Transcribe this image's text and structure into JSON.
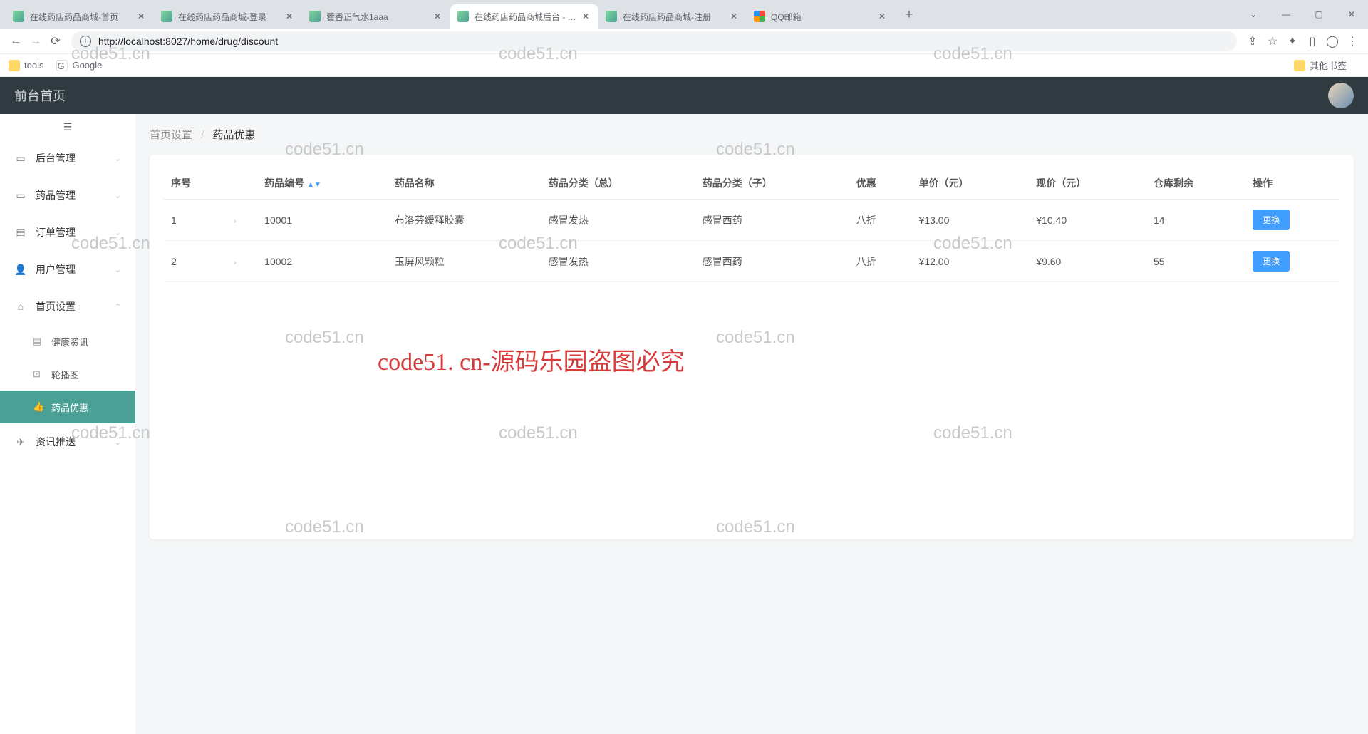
{
  "browser": {
    "tabs": [
      {
        "title": "在线药店药品商城-首页"
      },
      {
        "title": "在线药店药品商城-登录"
      },
      {
        "title": "藿香正气水1aaa"
      },
      {
        "title": "在线药店药品商城后台 - 药品"
      },
      {
        "title": "在线药店药品商城-注册"
      },
      {
        "title": "QQ邮箱"
      }
    ],
    "url": "http://localhost:8027/home/drug/discount",
    "bookmarks": {
      "tools": "tools",
      "google": "Google",
      "other": "其他书签"
    }
  },
  "nav": {
    "brand": "前台首页"
  },
  "sidebar": {
    "items": [
      {
        "icon": "▭",
        "label": "后台管理"
      },
      {
        "icon": "▭",
        "label": "药品管理"
      },
      {
        "icon": "▤",
        "label": "订单管理"
      },
      {
        "icon": "👤",
        "label": "用户管理"
      },
      {
        "icon": "⌂",
        "label": "首页设置"
      }
    ],
    "sub": [
      {
        "icon": "▤",
        "label": "健康资讯"
      },
      {
        "icon": "⊡",
        "label": "轮播图"
      },
      {
        "icon": "👍",
        "label": "药品优惠"
      }
    ],
    "last": {
      "icon": "✈",
      "label": "资讯推送"
    }
  },
  "breadcrumb": {
    "a": "首页设置",
    "b": "药品优惠"
  },
  "table": {
    "headers": {
      "seq": "序号",
      "id": "药品编号",
      "name": "药品名称",
      "cat1": "药品分类（总）",
      "cat2": "药品分类（子）",
      "disc": "优惠",
      "price": "单价（元）",
      "now": "现价（元）",
      "stock": "仓库剩余",
      "op": "操作"
    },
    "rows": [
      {
        "seq": "1",
        "id": "10001",
        "name": "布洛芬缓释胶囊",
        "cat1": "感冒发热",
        "cat2": "感冒西药",
        "disc": "八折",
        "price": "¥13.00",
        "now": "¥10.40",
        "stock": "14",
        "op": "更换"
      },
      {
        "seq": "2",
        "id": "10002",
        "name": "玉屏风颗粒",
        "cat1": "感冒发热",
        "cat2": "感冒西药",
        "disc": "八折",
        "price": "¥12.00",
        "now": "¥9.60",
        "stock": "55",
        "op": "更换"
      }
    ]
  },
  "wm": "code51.cn",
  "bigwm": "code51. cn-源码乐园盗图必究"
}
